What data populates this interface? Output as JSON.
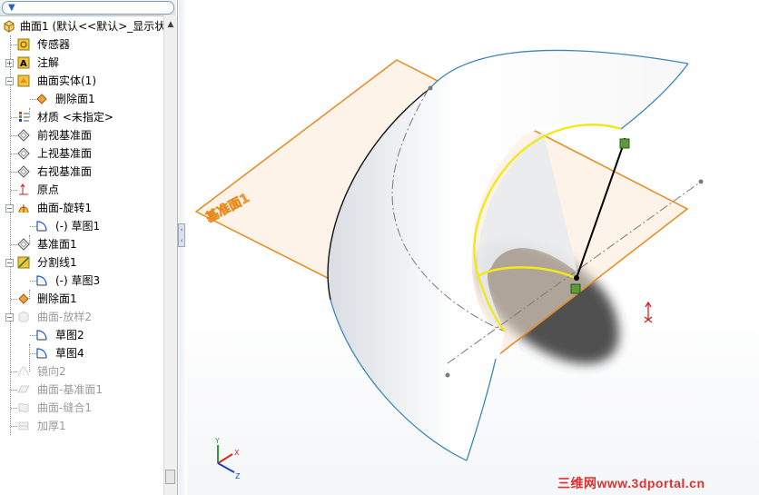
{
  "tree": {
    "root": {
      "label": "曲面1  (默认<<默认>_显示状"
    },
    "items": [
      {
        "label": "传感器",
        "icon": "sensor-icon",
        "dim": false
      },
      {
        "label": "注解",
        "icon": "annotation-icon",
        "dim": false
      },
      {
        "label": "曲面实体(1)",
        "icon": "surface-bodies-icon",
        "dim": false
      },
      {
        "label": "删除面1",
        "icon": "delete-face-icon",
        "dim": false
      },
      {
        "label": "材质 <未指定>",
        "icon": "material-icon",
        "dim": false
      },
      {
        "label": "前视基准面",
        "icon": "plane-icon",
        "dim": false
      },
      {
        "label": "上视基准面",
        "icon": "plane-icon",
        "dim": false
      },
      {
        "label": "右视基准面",
        "icon": "plane-icon",
        "dim": false
      },
      {
        "label": "原点",
        "icon": "origin-icon",
        "dim": false
      },
      {
        "label": "曲面-旋转1",
        "icon": "surface-revolve-icon",
        "dim": false
      },
      {
        "label": "(-) 草图1",
        "icon": "sketch-icon",
        "dim": false
      },
      {
        "label": "基准面1",
        "icon": "plane-icon",
        "dim": false
      },
      {
        "label": "分割线1",
        "icon": "split-line-icon",
        "dim": false
      },
      {
        "label": "(-) 草图3",
        "icon": "sketch-icon",
        "dim": false
      },
      {
        "label": "删除面1",
        "icon": "delete-face-icon",
        "dim": false
      },
      {
        "label": "曲面-放样2",
        "icon": "surface-loft-icon",
        "dim": true
      },
      {
        "label": "草图2",
        "icon": "sketch-icon",
        "dim": false
      },
      {
        "label": "草图4",
        "icon": "sketch-icon",
        "dim": false
      },
      {
        "label": "镜向2",
        "icon": "mirror-icon",
        "dim": true
      },
      {
        "label": "曲面-基准面1",
        "icon": "planar-surface-icon",
        "dim": true
      },
      {
        "label": "曲面-缝合1",
        "icon": "knit-icon",
        "dim": true
      },
      {
        "label": "加厚1",
        "icon": "thicken-icon",
        "dim": true
      }
    ]
  },
  "viewport": {
    "plane_label": "基准面1",
    "triad": {
      "x": "X",
      "y": "Y",
      "z": "Z"
    },
    "watermark": "三维网www.3dportal.cn"
  },
  "colors": {
    "plane_edge": "#e8891e",
    "yellow_edge": "#f2e81a",
    "surface_edge": "#3a86b4",
    "tree_icon_yellow": "#f3c53a"
  }
}
